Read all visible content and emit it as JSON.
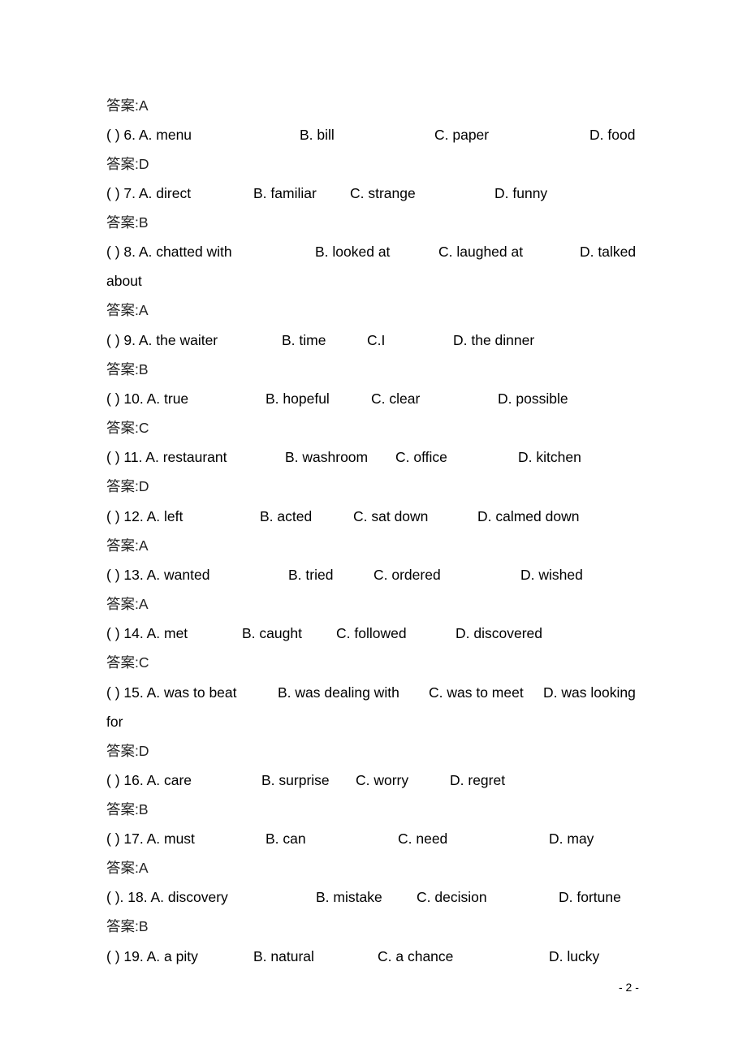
{
  "page_number": "- 2 -",
  "answer_label": "答案:",
  "first_answer": "A",
  "questions": [
    {
      "prefix": "(    ) 6. A. menu",
      "b": "B. bill",
      "c": "C. paper",
      "d": "D. food",
      "answer": "D"
    },
    {
      "prefix": "(    ) 7. A. direct",
      "b": "B. familiar",
      "c": "C. strange",
      "d": "D. funny",
      "answer": "B"
    },
    {
      "prefix": "(    ) 8. A. chatted with",
      "b": "B. looked at",
      "c": "C. laughed at",
      "d": "D. talked",
      "wrap": "about",
      "answer": "A"
    },
    {
      "prefix": "(    ) 9. A. the waiter",
      "b": "B. time",
      "c": "C.I",
      "d": "D. the dinner",
      "answer": "B"
    },
    {
      "prefix": "(    ) 10. A. true",
      "b": "B. hopeful",
      "c": "C. clear",
      "d": "D. possible",
      "answer": "C"
    },
    {
      "prefix": "(    ) 11. A. restaurant",
      "b": "B. washroom",
      "c": "C. office",
      "d": "D. kitchen",
      "answer": "D"
    },
    {
      "prefix": "(    ) 12. A. left",
      "b": "B. acted",
      "c": "C. sat down",
      "d": "D. calmed down",
      "answer": "A"
    },
    {
      "prefix": "(    ) 13. A. wanted",
      "b": "B. tried",
      "c": "C. ordered",
      "d": "D. wished",
      "answer": "A"
    },
    {
      "prefix": "(    ) 14. A. met",
      "b": "B. caught",
      "c": "C. followed",
      "d": "D. discovered",
      "answer": "C"
    },
    {
      "prefix": "(    ) 15. A. was to beat",
      "b": "B. was dealing with",
      "c": "C. was to meet",
      "d": "D. was looking",
      "wrap": "for",
      "answer": "D"
    },
    {
      "prefix": "(    ) 16. A. care",
      "b": "B. surprise",
      "c": "C. worry",
      "d": "D. regret",
      "answer": "B"
    },
    {
      "prefix": "(    ) 17. A. must",
      "b": "B. can",
      "c": "C. need",
      "d": "D. may",
      "answer": "A"
    },
    {
      "prefix": "(    ). 18. A. discovery",
      "b": "B. mistake",
      "c": "C. decision",
      "d": "D. fortune",
      "answer": "B"
    },
    {
      "prefix": "(    ) 19. A. a pity",
      "b": "B. natural",
      "c": "C. a chance",
      "d": "D. lucky"
    }
  ]
}
